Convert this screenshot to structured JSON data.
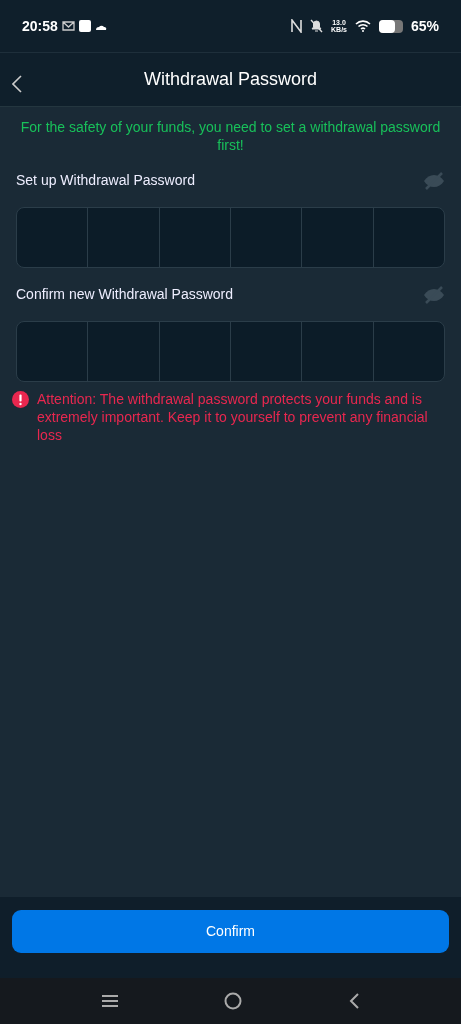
{
  "status_bar": {
    "time": "20:58",
    "speed_value": "13.0",
    "speed_unit": "KB/s",
    "battery": "65%"
  },
  "header": {
    "title": "Withdrawal Password"
  },
  "notice": "For the safety of your funds, you need to set a withdrawal password first!",
  "fields": [
    {
      "label": "Set up Withdrawal Password",
      "password_visible": false
    },
    {
      "label": "Confirm new Withdrawal Password",
      "password_visible": false
    }
  ],
  "warning": "Attention: The withdrawal password protects your funds and is extremely important. Keep it to yourself to prevent any financial loss",
  "button": "Confirm"
}
